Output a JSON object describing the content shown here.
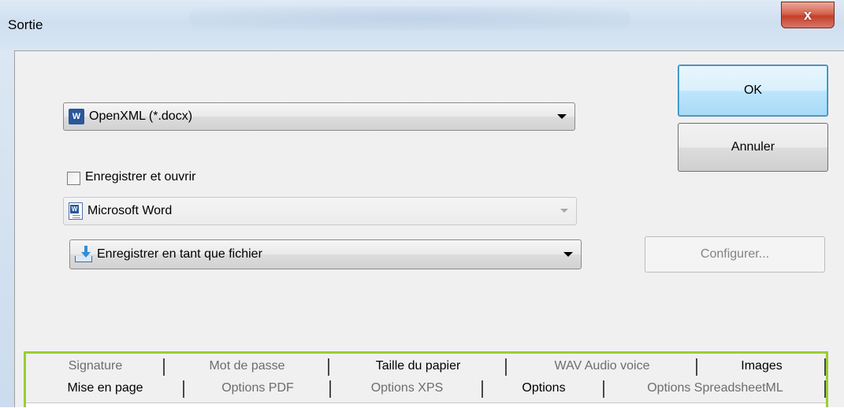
{
  "window": {
    "title": "Sortie",
    "close_label": "x"
  },
  "format": {
    "selected": "OpenXML (*.docx)",
    "icon": "word-w-icon"
  },
  "save_open": {
    "checkbox_label": "Enregistrer et ouvrir",
    "checked": false,
    "application": "Microsoft Word",
    "application_icon": "word-document-icon"
  },
  "destination": {
    "selected": "Enregistrer en tant que fichier",
    "icon": "save-download-icon"
  },
  "buttons": {
    "ok": "OK",
    "cancel": "Annuler",
    "configure": "Configurer..."
  },
  "tabs": {
    "row1": [
      {
        "label": "Signature",
        "active": false
      },
      {
        "label": "Mot de passe",
        "active": false
      },
      {
        "label": "Taille du papier",
        "active": true
      },
      {
        "label": "WAV Audio voice",
        "active": false
      },
      {
        "label": "Images",
        "active": true
      }
    ],
    "row2": [
      {
        "label": "Mise en page",
        "active": true
      },
      {
        "label": "Options PDF",
        "active": false
      },
      {
        "label": "Options XPS",
        "active": false
      },
      {
        "label": "Options",
        "active": true
      },
      {
        "label": "Options SpreadsheetML",
        "active": false
      }
    ]
  },
  "colors": {
    "tab_highlight": "#9acd32",
    "close_button": "#c3402a",
    "default_button": "#3c7fb1"
  }
}
